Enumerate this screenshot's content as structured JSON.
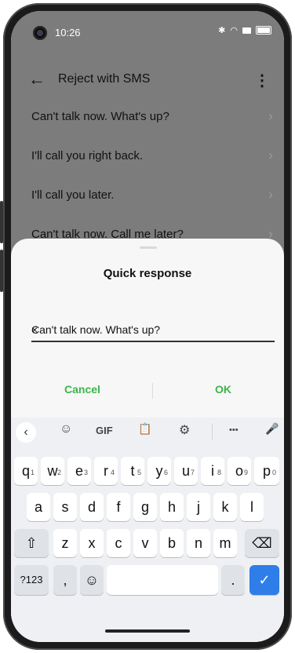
{
  "status_bar": {
    "time": "10:26",
    "icons": [
      "bluetooth-icon",
      "wifi-icon",
      "nfc-icon",
      "battery-icon"
    ]
  },
  "app_bar": {
    "title": "Reject with SMS",
    "back_icon": "←",
    "more_icon": "⋮"
  },
  "messages": [
    {
      "text": "Can't talk now. What's up?"
    },
    {
      "text": "I'll call you right back."
    },
    {
      "text": "I'll call you later."
    },
    {
      "text": "Can't talk now. Call me later?"
    }
  ],
  "dialog": {
    "title": "Quick response",
    "input_value": "Can't talk now. What's up?",
    "clear_icon": "×",
    "cancel_label": "Cancel",
    "ok_label": "OK",
    "accent_color": "#3bb54a"
  },
  "keyboard": {
    "toolbar": {
      "back": "‹",
      "sticker": "☺",
      "gif": "GIF",
      "clipboard": "📋",
      "settings": "⚙",
      "more": "•••",
      "mic": "🎤"
    },
    "row1": [
      {
        "k": "q",
        "n": "1"
      },
      {
        "k": "w",
        "n": "2"
      },
      {
        "k": "e",
        "n": "3"
      },
      {
        "k": "r",
        "n": "4"
      },
      {
        "k": "t",
        "n": "5"
      },
      {
        "k": "y",
        "n": "6"
      },
      {
        "k": "u",
        "n": "7"
      },
      {
        "k": "i",
        "n": "8"
      },
      {
        "k": "o",
        "n": "9"
      },
      {
        "k": "p",
        "n": "0"
      }
    ],
    "row2": [
      "a",
      "s",
      "d",
      "f",
      "g",
      "h",
      "j",
      "k",
      "l"
    ],
    "row3": [
      "z",
      "x",
      "c",
      "v",
      "b",
      "n",
      "m"
    ],
    "shift": "⇧",
    "backspace": "⌫",
    "symbols": "?123",
    "comma": ",",
    "emoji": "☺",
    "period": ".",
    "enter": "✓",
    "enter_color": "#2f7de8"
  }
}
